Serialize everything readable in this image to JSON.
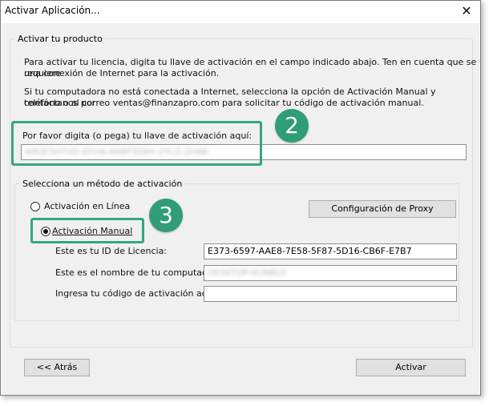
{
  "window": {
    "title": "Activar Aplicación...",
    "close_glyph": "✕"
  },
  "product": {
    "legend": "Activar tu producto",
    "intro_line1": "Para activar tu licencia, digita tu llave de activación en el campo indicado abajo.  Ten en cuenta que se requiere",
    "intro_line2": "una conexión de Internet para la activación.",
    "offline_line1": "Si tu computadora no está conectada a Internet, selecciona la opción de Activación Manual y contáctanos por",
    "offline_line2": "teléfono o al correo ventas@finanzapro.com para solicitar tu código de activación manual.",
    "key_label": "Por favor digita (o pega) tu llave de activación aquí:",
    "key_value": "A9QE5HYVD-EFHA-A6BF5E6H-2YCZ-2HAB"
  },
  "method": {
    "legend": "Selecciona un método de activación",
    "online_label": "Activación en Línea",
    "manual_label": "Activación Manual",
    "proxy_button": "Configuración de Proxy",
    "license_id_label": "Este es tu ID de Licencia:",
    "license_id_value": "E373-6597-AAE8-7E58-5F87-5D16-CB6F-E7B7",
    "computer_name_label": "Este es el nombre de tu computadora:",
    "computer_name_value": "DESKTOP-6UN8L0",
    "manual_code_label": "Ingresa tu código de activación aquí:",
    "manual_code_value": ""
  },
  "footer": {
    "back_button": "<< Atrás",
    "activate_button": "Activar"
  },
  "annotations": {
    "step2": "2",
    "step3": "3"
  },
  "colors": {
    "callout": "#35a67e",
    "badge": "#2f9d76"
  }
}
